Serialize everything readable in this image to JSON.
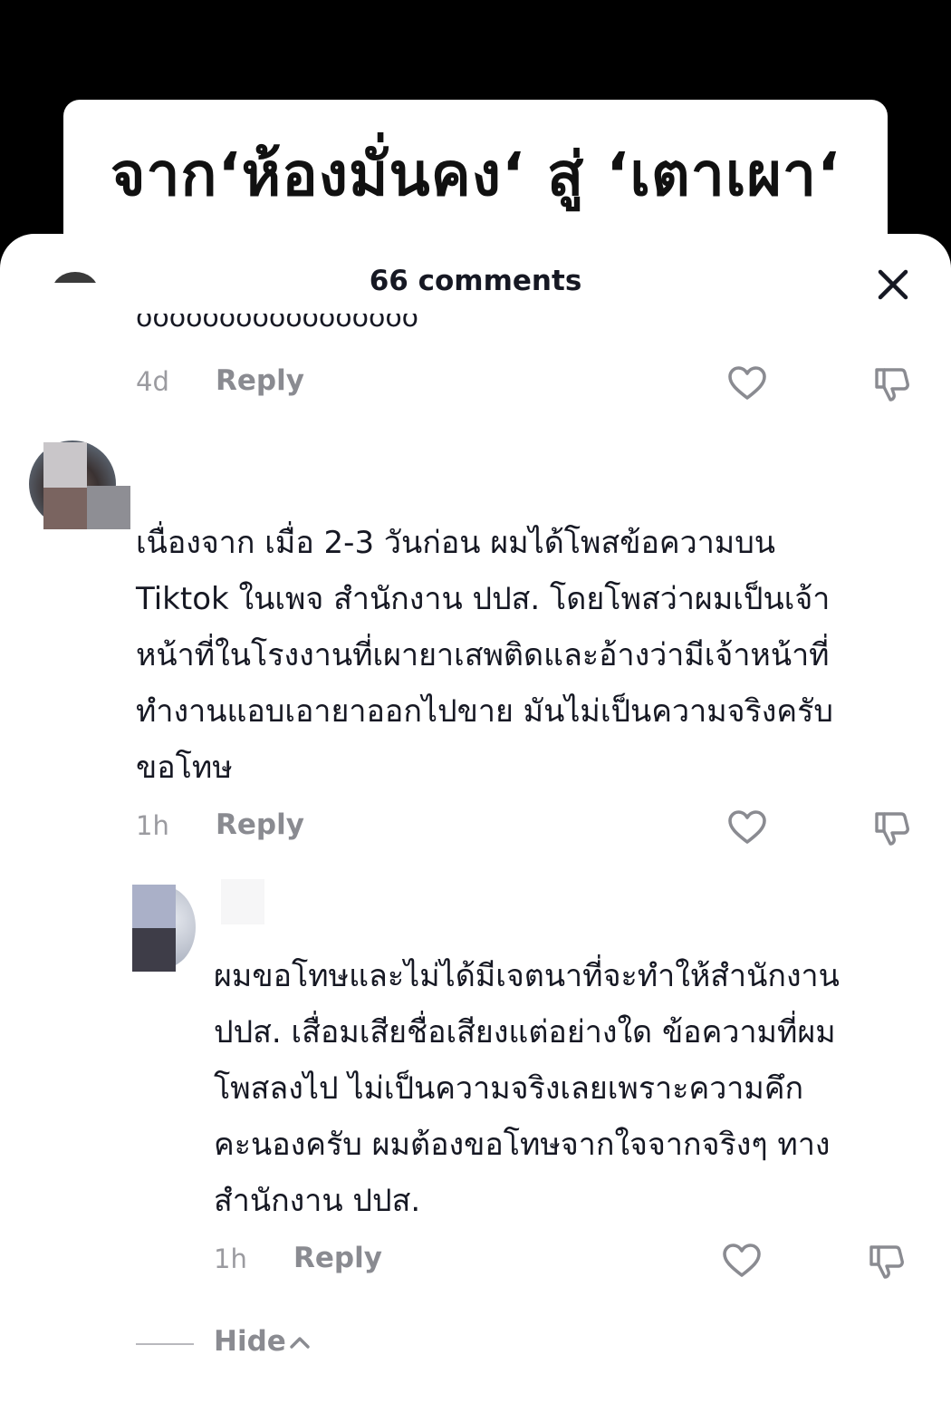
{
  "video": {
    "title": "จาก‘ห้องมั่นคง‘ สู่ ‘เตาเผา‘"
  },
  "sheet": {
    "comment_count_label": "66 comments"
  },
  "icons": {
    "close": "close-icon",
    "like": "heart-icon",
    "dislike": "thumbs-down-icon",
    "hide": "chevron-up-icon"
  },
  "truncated_comment": {
    "text": "ooooooooooooooooo",
    "time": "4d",
    "reply_label": "Reply"
  },
  "comment_1": {
    "text": "เนื่องจาก เมื่อ 2-3 วันก่อน ผมได้โพสข้อความบน\nTiktok ในเพจ สำนักงาน ปปส. โดยโพสว่าผมเป็นเจ้า\nหน้าที่ในโรงงานที่เผายาเสพติดและอ้างว่ามีเจ้าหน้าที่\nทำงานแอบเอายาออกไปขาย มันไม่เป็นความจริงครับ\nขอโทษ",
    "time": "1h",
    "reply_label": "Reply"
  },
  "reply_1": {
    "text": "ผมขอโทษและไม่ได้มีเจตนาที่จะทำให้สำนักงาน\nปปส. เสื่อมเสียชื่อเสียงแต่อย่างใด ข้อความที่ผม\nโพสลงไป ไม่เป็นความจริงเลยเพราะความคึก\nคะนองครับ ผมต้องขอโทษจากใจจากจริงๆ ทาง\nสำนักงาน ปปส.",
    "time": "1h",
    "reply_label": "Reply"
  },
  "replies_toggle": {
    "label": "Hide"
  }
}
